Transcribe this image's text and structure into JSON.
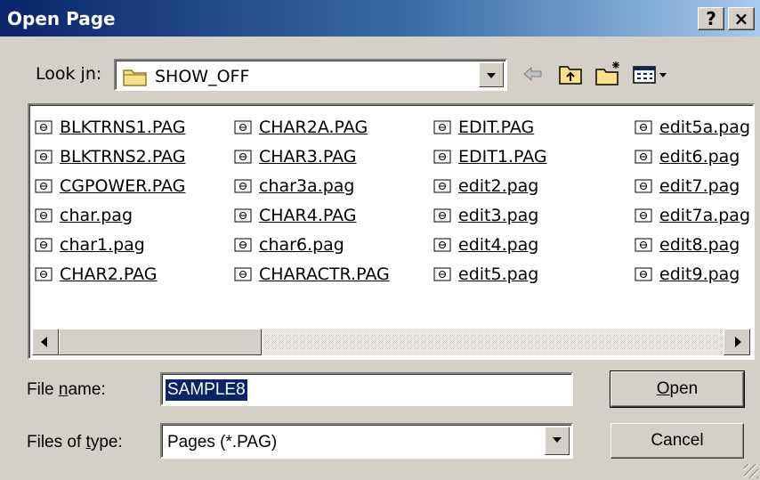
{
  "window": {
    "title": "Open Page",
    "help_label": "?",
    "close_label": "×"
  },
  "lookin": {
    "label_prefix": "Look ",
    "label_accel": "j",
    "label_suffix": "n:",
    "value": "SHOW_OFF"
  },
  "toolbar": {
    "icons": [
      "back-icon",
      "up-folder-icon",
      "new-folder-icon",
      "view-menu-icon"
    ]
  },
  "files": {
    "columns": [
      [
        "BLKTRNS1.PAG",
        "BLKTRNS2.PAG",
        "CGPOWER.PAG",
        "char.pag",
        "char1.pag",
        "CHAR2.PAG"
      ],
      [
        "CHAR2A.PAG",
        "CHAR3.PAG",
        "char3a.pag",
        "CHAR4.PAG",
        "char6.pag",
        "CHARACTR.PAG"
      ],
      [
        "EDIT.PAG",
        "EDIT1.PAG",
        "edit2.pag",
        "edit3.pag",
        "edit4.pag",
        "edit5.pag"
      ],
      [
        "edit5a.pag",
        "edit6.pag",
        "edit7.pag",
        "edit7a.pag",
        "edit8.pag",
        "edit9.pag"
      ]
    ]
  },
  "filename": {
    "label_prefix": "File ",
    "label_accel": "n",
    "label_suffix": "ame:",
    "value": "SAMPLE8"
  },
  "filetype": {
    "label_prefix": "Files of ",
    "label_accel": "t",
    "label_suffix": "ype:",
    "value": "Pages (*.PAG)"
  },
  "buttons": {
    "open_accel": "O",
    "open_rest": "pen",
    "cancel": "Cancel"
  }
}
